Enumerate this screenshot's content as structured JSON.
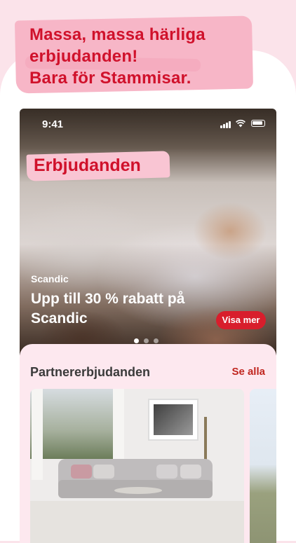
{
  "promo": {
    "lines": [
      "Massa, massa  härliga",
      "erbjudanden!",
      "Bara för Stammisar."
    ]
  },
  "status_bar": {
    "time": "9:41"
  },
  "hero": {
    "section_title": "Erbjudanden",
    "brand": "Scandic",
    "offer_title": "Upp till 30 % rabatt på Scandic",
    "cta_label": "Visa mer",
    "carousel": {
      "total": 3,
      "active": 1
    }
  },
  "partners": {
    "heading": "Partnererbjudanden",
    "see_all": "Se alla"
  },
  "colors": {
    "brand_red": "#d0112b",
    "cta_red": "#d81e2c",
    "pink_background": "#fbe3ea",
    "highlight_pink": "#f7b6c7"
  }
}
